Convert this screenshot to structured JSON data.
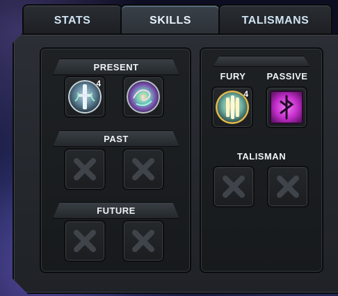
{
  "tabs": [
    {
      "label": "STATS",
      "active": false
    },
    {
      "label": "SKILLS",
      "active": true
    },
    {
      "label": "TALISMANS",
      "active": false
    }
  ],
  "left_panel": {
    "sections": [
      {
        "title": "PRESENT",
        "slots": [
          {
            "state": "filled",
            "icon": "sword-glyph-icon",
            "level": "4"
          },
          {
            "state": "filled",
            "icon": "swirl-orb-icon",
            "level": ""
          }
        ]
      },
      {
        "title": "PAST",
        "slots": [
          {
            "state": "empty",
            "icon": "empty-slot-x-icon"
          },
          {
            "state": "empty",
            "icon": "empty-slot-x-icon"
          }
        ]
      },
      {
        "title": "FUTURE",
        "slots": [
          {
            "state": "empty",
            "icon": "empty-slot-x-icon"
          },
          {
            "state": "empty",
            "icon": "empty-slot-x-icon"
          }
        ]
      }
    ]
  },
  "right_panel": {
    "fury": {
      "title": "FURY",
      "icon": "golden-fury-orb-icon",
      "level": "4"
    },
    "passive": {
      "title": "PASSIVE",
      "icon": "purple-rune-icon"
    },
    "talisman": {
      "title": "TALISMAN",
      "slots": [
        {
          "state": "empty",
          "icon": "empty-slot-x-icon"
        },
        {
          "state": "empty",
          "icon": "empty-slot-x-icon"
        }
      ]
    }
  },
  "colors": {
    "panel_bg": "#1e2124",
    "frame_bg": "#2b2f35",
    "accent_tab_glow": "#78c8f0",
    "passive_purple": "#c02cc8",
    "fury_gold": "#d8b34a"
  }
}
